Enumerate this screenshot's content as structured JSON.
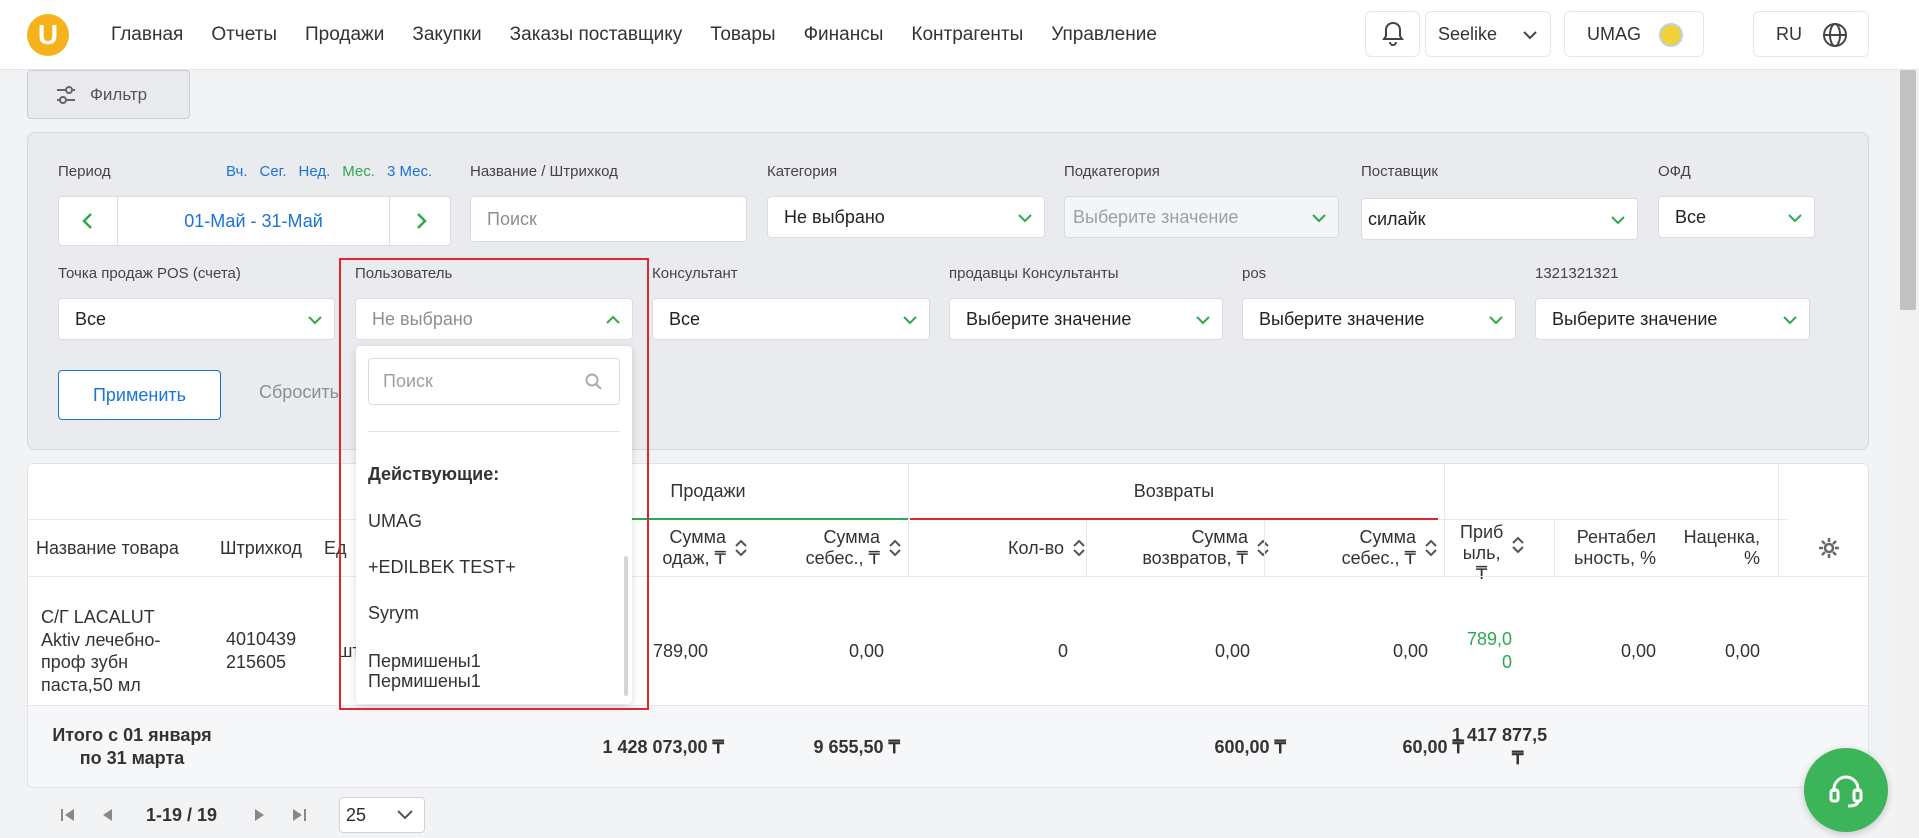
{
  "nav": {
    "items": [
      "Главная",
      "Отчеты",
      "Продажи",
      "Закупки",
      "Заказы поставщику",
      "Товары",
      "Финансы",
      "Контрагенты",
      "Управление"
    ]
  },
  "header": {
    "store": "Seelike",
    "company": "UMAG",
    "lang": "RU"
  },
  "filter_button": "Фильтр",
  "filters": {
    "period_label": "Период",
    "period_links": [
      "Вч.",
      "Сег.",
      "Нед.",
      "Мес.",
      "3 Мес."
    ],
    "date_range": "01-Май  -  31-Май",
    "name_label": "Название / Штрихкод",
    "name_placeholder": "Поиск",
    "category_label": "Категория",
    "category_value": "Не выбрано",
    "subcategory_label": "Подкатегория",
    "subcategory_value": "Выберите значение",
    "supplier_label": "Поставщик",
    "supplier_value": "силайк",
    "ofd_label": "ОФД",
    "ofd_value": "Все",
    "pos_label": "Точка продаж POS (счета)",
    "pos_value": "Все",
    "user_label": "Пользователь",
    "user_value": "Не выбрано",
    "consultant_label": "Консультант",
    "consultant_value": "Все",
    "sellers_label": "продавцы Консультанты",
    "sellers_value": "Выберите значение",
    "pos2_label": "pos",
    "pos2_value": "Выберите значение",
    "num_label": "1321321321",
    "num_value": "Выберите значение",
    "apply": "Применить",
    "reset": "Сбросить"
  },
  "dropdown": {
    "search_placeholder": "Поиск",
    "section": "Действующие:",
    "items": [
      "UMAG",
      "+EDILBEK TEST+",
      "Syrym",
      "Пермишены1",
      "Пермишены1"
    ]
  },
  "table": {
    "group_sales": "Продажи",
    "group_returns": "Возвраты",
    "col_name": "Название товара",
    "col_barcode": "Штрихкод",
    "col_unit": "Ед",
    "col_sales_sum_1": "Сумма",
    "col_sales_sum_2": "одаж, ₸",
    "col_sales_cost_1": "Сумма",
    "col_sales_cost_2": "себес., ₸",
    "col_ret_qty": "Кол-во",
    "col_ret_sum_1": "Сумма",
    "col_ret_sum_2": "возвратов, ₸",
    "col_ret_cost_1": "Сумма",
    "col_ret_cost_2": "себес., ₸",
    "col_profit_1": "Приб",
    "col_profit_2": "ыль,",
    "col_profit_3": "₸",
    "col_rent_1": "Рентабел",
    "col_rent_2": "ьность, %",
    "col_markup_1": "Наценка,",
    "col_markup_2": "%",
    "row": {
      "name_1": "С/Г LACALUT",
      "name_2": "Aktiv лечебно-",
      "name_3": "проф зубн",
      "name_4": "паста,50 мл",
      "barcode_1": "4010439",
      "barcode_2": "215605",
      "unit": "шт",
      "sales_sum": "789,00",
      "sales_cost": "0,00",
      "ret_qty": "0",
      "ret_sum": "0,00",
      "ret_cost": "0,00",
      "profit_1": "789,0",
      "profit_2": "0",
      "rent": "0,00",
      "markup": "0,00"
    },
    "total": {
      "label_1": "Итого с 01 января",
      "label_2": "по 31 марта",
      "sales_sum": "1 428 073,00 ₸",
      "sales_cost": "9 655,50 ₸",
      "ret_sum": "600,00 ₸",
      "ret_cost": "60,00 ₸",
      "profit_1": "1 417 877,5",
      "profit_2": "₸"
    }
  },
  "pager": {
    "range": "1-19 / 19",
    "page_size": "25"
  },
  "colors": {
    "accent": "#1a73d9",
    "green": "#2ea84f",
    "red": "#e3262e",
    "logo": "#f6b21b"
  }
}
